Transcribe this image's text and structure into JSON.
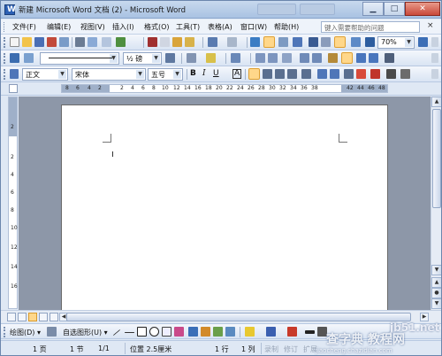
{
  "window": {
    "title": "新建 Microsoft Word 文档 (2) - Microsoft Word"
  },
  "menu": {
    "items": [
      "文件(F)",
      "编辑(E)",
      "视图(V)",
      "插入(I)",
      "格式(O)",
      "工具(T)",
      "表格(A)",
      "窗口(W)",
      "帮助(H)"
    ],
    "help_placeholder": "键入需要帮助的问题",
    "close_glyph": "×"
  },
  "toolbar_standard": {
    "zoom": "70%"
  },
  "toolbar_drawing_lines": {
    "font_size_label": "½ 磅"
  },
  "toolbar_format": {
    "style": "正文",
    "font": "宋体",
    "size": "五号",
    "bold": "B",
    "italic": "I",
    "underline": "U",
    "char_border": "A"
  },
  "ruler": {
    "numbers": [
      "8",
      "6",
      "4",
      "2",
      "2",
      "4",
      "6",
      "8",
      "10",
      "12",
      "14",
      "16",
      "18",
      "20",
      "22",
      "24",
      "26",
      "28",
      "30",
      "32",
      "34",
      "36",
      "38",
      "42",
      "44",
      "46",
      "48"
    ],
    "vertical_numbers": [
      "2",
      "2",
      "4",
      "6",
      "8",
      "10",
      "12",
      "14",
      "16"
    ]
  },
  "drawing_toolbar": {
    "draw_label": "绘图(D) ▾",
    "autoshape_label": "自选图形(U) ▾"
  },
  "statusbar": {
    "page": "1 页",
    "section": "1 节",
    "page_of": "1/1",
    "position": "位置 2.5厘米",
    "line": "1 行",
    "column": "1 列",
    "modes": [
      "录制",
      "修订",
      "扩展"
    ]
  },
  "watermark": {
    "site": "jb51.net",
    "text": "查字典 教程网",
    "url": "jiaocheng.chazidian.com"
  }
}
